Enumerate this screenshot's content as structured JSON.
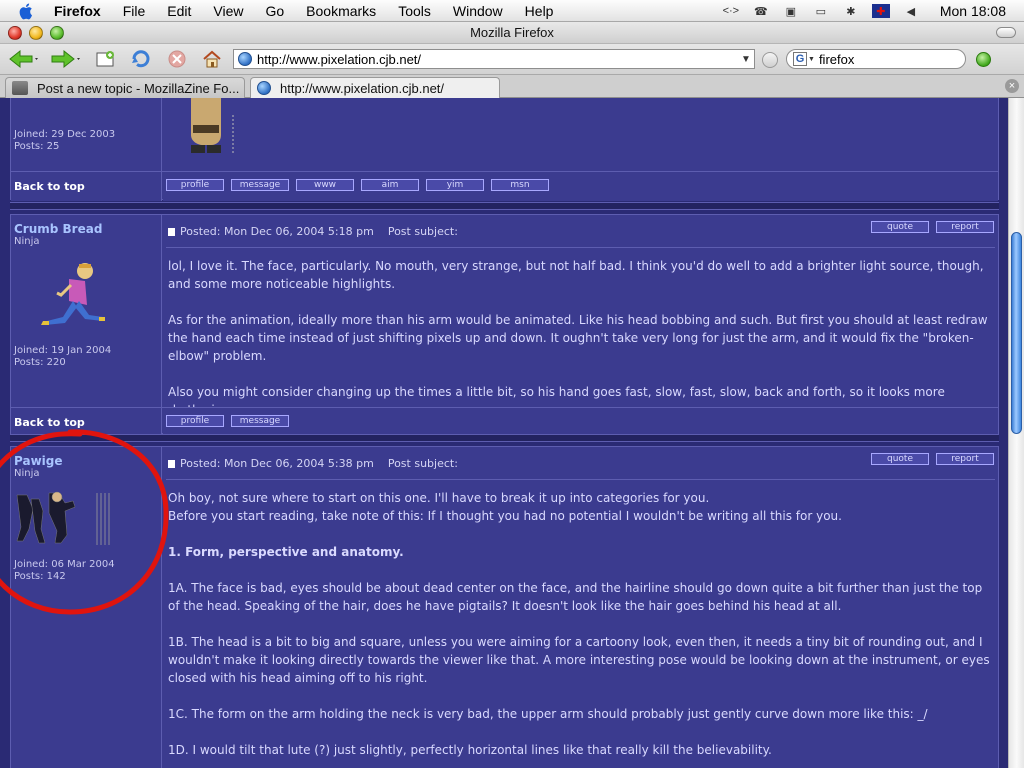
{
  "menubar": {
    "app_name": "Firefox",
    "menus": [
      "File",
      "Edit",
      "View",
      "Go",
      "Bookmarks",
      "Tools",
      "Window",
      "Help"
    ],
    "clock": "Mon 18:08"
  },
  "window": {
    "title": "Mozilla Firefox"
  },
  "toolbar": {
    "url": "http://www.pixelation.cjb.net/",
    "search_value": "firefox",
    "search_engine_letter": "G"
  },
  "tabs": [
    {
      "label": "Post a new topic - MozillaZine Fo...",
      "active": false
    },
    {
      "label": "http://www.pixelation.cjb.net/",
      "active": true
    }
  ],
  "forum": {
    "top_post": {
      "joined": "Joined: 29 Dec 2003",
      "posts": "Posts: 25",
      "back_to_top": "Back to top",
      "buttons": [
        "profile",
        "message",
        "www",
        "aim",
        "yim",
        "msn"
      ]
    },
    "post1": {
      "author": "Crumb Bread",
      "rank": "Ninja",
      "joined": "Joined: 19 Jan 2004",
      "posts": "Posts: 220",
      "posted": "Posted: Mon Dec 06, 2004 5:18 pm",
      "subject_label": "Post subject:",
      "quote_label": "quote",
      "report_label": "report",
      "body": [
        "lol, I love it. The face, particularly. No mouth, very strange, but not half bad. I think you'd do well to add a brighter light source, though, and some more noticeable highlights.",
        "As for the animation, ideally more than his arm would be animated. Like his head bobbing and such. But first you should at least redraw the hand each time instead of just shifting pixels up and down. It oughn't take very long for just the arm, and it would fix the \"broken-elbow\" problem.",
        "Also you might consider changing up the times a little bit, so his hand goes fast, slow, fast, slow, back and forth, so it looks more rhythmic."
      ],
      "back_to_top": "Back to top",
      "buttons": [
        "profile",
        "message"
      ]
    },
    "post2": {
      "author": "Pawige",
      "rank": "Ninja",
      "joined": "Joined: 06 Mar 2004",
      "posts": "Posts: 142",
      "posted": "Posted: Mon Dec 06, 2004 5:38 pm",
      "subject_label": "Post subject:",
      "quote_label": "quote",
      "report_label": "report",
      "intro_1": "Oh boy, not sure where to start on this one. I'll have to break it up into categories for you.",
      "intro_2": "Before you start reading, take note of this: If I thought you had no potential I wouldn't be writing all this for you.",
      "heading": "1. Form, perspective and anatomy.",
      "p_1a": "1A. The face is bad, eyes should be about dead center on the face, and the hairline should go down quite a bit further than just the top of the head. Speaking of the hair, does he have pigtails? It doesn't look like the hair goes behind his head at all.",
      "p_1b": "1B. The head is a bit to big and square, unless you were aiming for a cartoony look, even then, it needs a tiny bit of rounding out, and I wouldn't make it looking directly towards the viewer like that. A more interesting pose would be looking down at the instrument, or eyes closed with his head aiming off to his right.",
      "p_1c": "1C. The form on the arm holding the neck is very bad, the upper arm should probably just gently curve down more like this: _/",
      "p_1d": "1D. I would tilt that lute (?) just slightly, perfectly horizontal lines like that really kill the believability."
    }
  },
  "colors": {
    "page_bg": "#2a2a74",
    "cell_bg": "#3b3b8f",
    "author_link": "#a9c4ff",
    "body_text": "#d9d9ff",
    "highlight_circle": "#e0140e"
  }
}
